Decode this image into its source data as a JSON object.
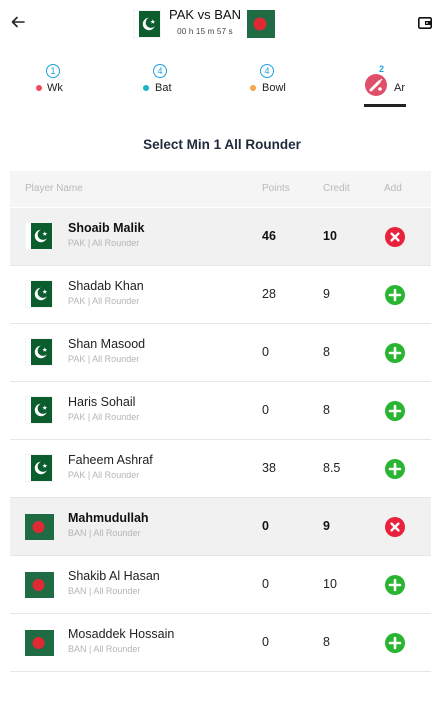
{
  "header": {
    "match_title": "PAK vs BAN",
    "timer": "00 h 15 m 57 s",
    "back_icon": "arrow-left-icon",
    "wallet_icon": "wallet-icon"
  },
  "colors": {
    "accent": "#1da1e1",
    "pakistan_green": "#0b5d2e",
    "bangladesh_green": "#1f6b44",
    "bangladesh_red": "#e02a33",
    "add_green": "#29b431",
    "remove_red": "#e8223d",
    "wk_dot": "#e94b5b",
    "bat_dot": "#19b5c8",
    "bowl_dot": "#f3a64a"
  },
  "tabs": [
    {
      "count": "1",
      "label": "Wk"
    },
    {
      "count": "4",
      "label": "Bat"
    },
    {
      "count": "4",
      "label": "Bowl"
    },
    {
      "count": "2",
      "label": "Ar"
    }
  ],
  "section_title": "Select Min 1 All Rounder",
  "table": {
    "headers": {
      "player": "Player Name",
      "points": "Points",
      "credit": "Credit",
      "add": "Add"
    },
    "rows": [
      {
        "name": "Shoaib Malik",
        "meta": "PAK | All Rounder",
        "points": "46",
        "credit": "10",
        "selected": true
      },
      {
        "name": "Shadab Khan",
        "meta": "PAK | All Rounder",
        "points": "28",
        "credit": "9",
        "selected": false
      },
      {
        "name": "Shan Masood",
        "meta": "PAK | All Rounder",
        "points": "0",
        "credit": "8",
        "selected": false
      },
      {
        "name": "Haris Sohail",
        "meta": "PAK | All Rounder",
        "points": "0",
        "credit": "8",
        "selected": false
      },
      {
        "name": "Faheem Ashraf",
        "meta": "PAK | All Rounder",
        "points": "38",
        "credit": "8.5",
        "selected": false
      },
      {
        "name": "Mahmudullah",
        "meta": "BAN | All Rounder",
        "points": "0",
        "credit": "9",
        "selected": true
      },
      {
        "name": "Shakib Al Hasan",
        "meta": "BAN | All Rounder",
        "points": "0",
        "credit": "10",
        "selected": false
      },
      {
        "name": "Mosaddek Hossain",
        "meta": "BAN | All Rounder",
        "points": "0",
        "credit": "8",
        "selected": false
      }
    ]
  }
}
